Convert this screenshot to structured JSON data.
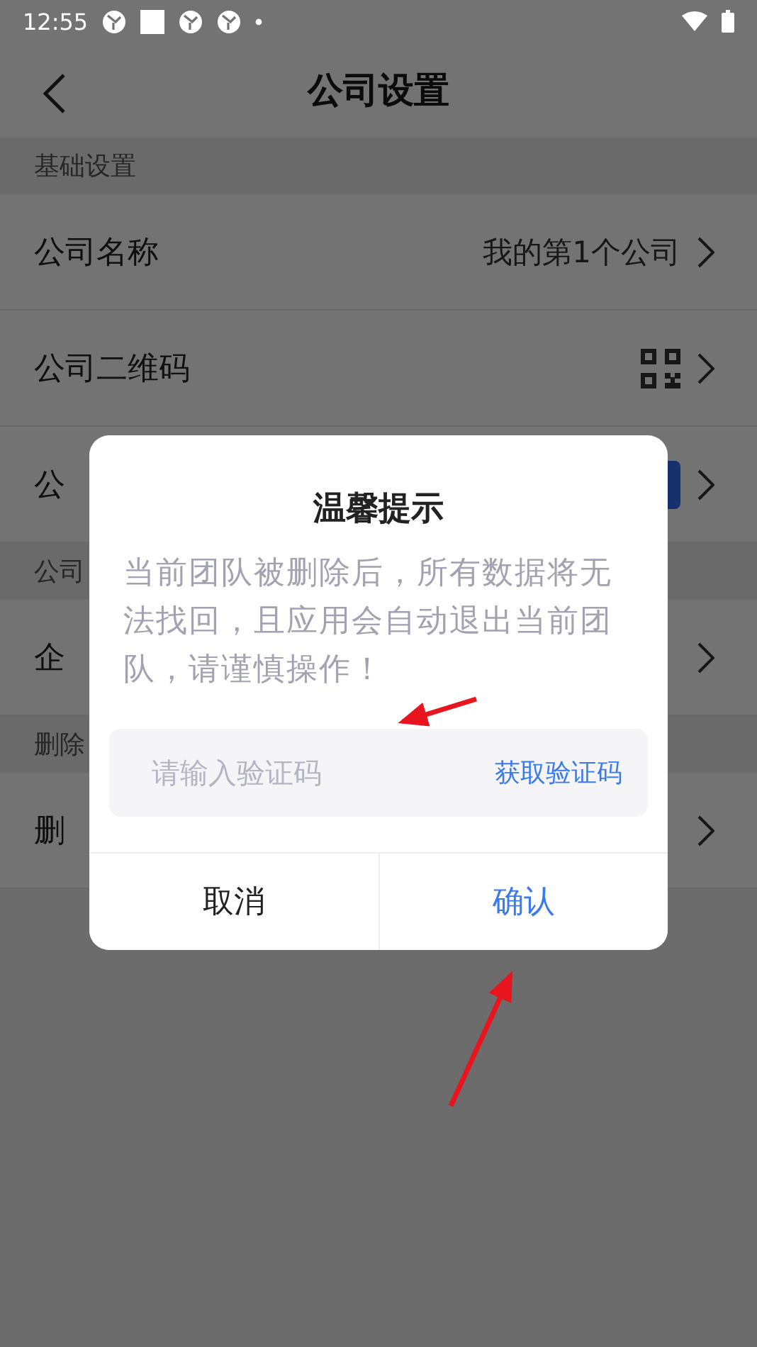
{
  "status_bar": {
    "time": "12:55"
  },
  "nav": {
    "title": "公司设置"
  },
  "sections": [
    {
      "header": "基础设置",
      "rows": [
        {
          "label": "公司名称",
          "kind": "value",
          "value": "我的第1个公司"
        },
        {
          "label": "公司二维码",
          "kind": "qr"
        },
        {
          "label": "公",
          "kind": "badge"
        }
      ]
    },
    {
      "header": "公司",
      "rows": [
        {
          "label": "企",
          "kind": "plain"
        }
      ]
    },
    {
      "header": "删除",
      "rows": [
        {
          "label": "删",
          "kind": "plain"
        }
      ]
    }
  ],
  "dialog": {
    "title": "温馨提示",
    "message": "当前团队被删除后，所有数据将无法找回，且应用会自动退出当前团队，请谨慎操作！",
    "code_field": {
      "placeholder": "请输入验证码"
    },
    "get_code": "获取验证码",
    "buttons": [
      {
        "label": "取消",
        "kind": "cancel"
      },
      {
        "label": "确认",
        "kind": "confirm"
      }
    ]
  }
}
